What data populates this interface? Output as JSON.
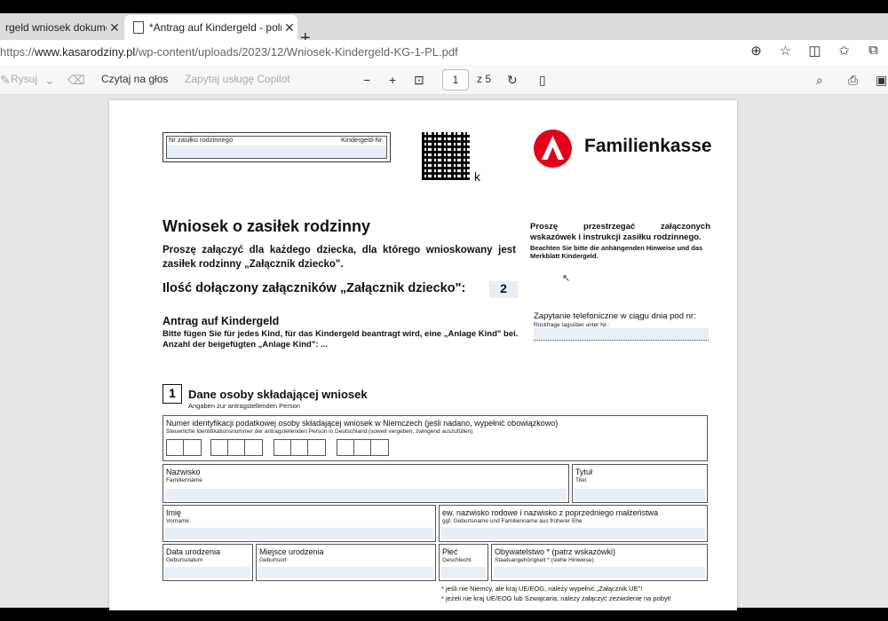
{
  "browser": {
    "tabs": [
      {
        "title": "rgeld wniosek dokumenty",
        "active": false
      },
      {
        "title": "*Antrag auf Kindergeld - polnisc",
        "active": true
      }
    ],
    "new_tab": "+",
    "url_prefix": "https://",
    "url_host": "www.kasarodziny.pl",
    "url_path": "/wp-content/uploads/2023/12/Wniosek-Kindergeld-KG-1-PL.pdf"
  },
  "pdf_toolbar": {
    "draw": "Rysuj",
    "read_aloud": "Czytaj na głos",
    "copilot": "Zapytaj usługę Copilot",
    "page": "1",
    "of_pages": "z 5"
  },
  "doc": {
    "id_label": "Nr zasiłku rodzinnego",
    "id_label_de": "Kindergeld-Nr.",
    "k": "k",
    "logo_text": "Familienkasse",
    "title": "Wniosek o zasiłek rodzinny",
    "intro": "Proszę załączyć dla każdego dziecka, dla którego wnioskowany jest zasiłek rodzinny „Załącznik dziecko\".",
    "count_label": "Ilość dołączony załączników „Załącznik dziecko\":",
    "count_value": "2",
    "de_title": "Antrag auf Kindergeld",
    "de_text": "Bitte fügen Sie für jedes Kind, für das Kindergeld beantragt wird, eine „Anlage Kind\" bei. Anzahl der beigefügten „Anlage Kind\": ...",
    "right_pl": "Proszę przestrzegać załączonych wskazówek i instrukcji zasiłku rodzinnego.",
    "right_de": "Beachten Sie bitte die anhängenden Hinweise und das Merkblatt Kindergeld.",
    "phone_pl": "Zapytanie telefoniczne w ciągu dnia pod nr:",
    "phone_de": "Rückfrage tagsüber unter Nr.:",
    "section_num": "1",
    "section_title": "Dane osoby składającej wniosek",
    "section_sub": "Angaben zur antragstellenden Person",
    "taxid_label": "Numer identyfikacji podatkowej osoby składającej wniosek w Niemczech (jeśli nadano, wypełnić obowiązkowo)",
    "taxid_sub": "Steuerliche Identifikationsnummer der antragstellenden Person in Deutschland (soweit vergeben, zwingend auszufüllen)",
    "surname": "Nazwisko",
    "surname_de": "Familienname",
    "title_f": "Tytuł",
    "title_f_de": "Titel",
    "firstname": "Imię",
    "firstname_de": "Vorname",
    "birthname": "ew. nazwisko rodowe i nazwisko z poprzedniego małżeństwa",
    "birthname_de": "ggf. Geburtsname und Familienname aus früherer Ehe",
    "dob": "Data urodzenia",
    "dob_de": "Geburtsdatum",
    "pob": "Miejsce urodzenia",
    "pob_de": "Geburtsort",
    "sex": "Płeć",
    "sex_de": "Geschlecht",
    "citizenship": "Obywatelstwo * (patrz wskazówki)",
    "citizenship_de": "Staatsangehörigkeit * (siehe Hinweise)",
    "note1": "* jeśli nie Niemcy, ale kraj UE/EOG, należy wypełnić „Załącznik UE\"!",
    "note2": "* jeżeli nie kraj UE/EOG lub Szwajcaria, należy załączyć zezwolenie na pobyt!"
  }
}
